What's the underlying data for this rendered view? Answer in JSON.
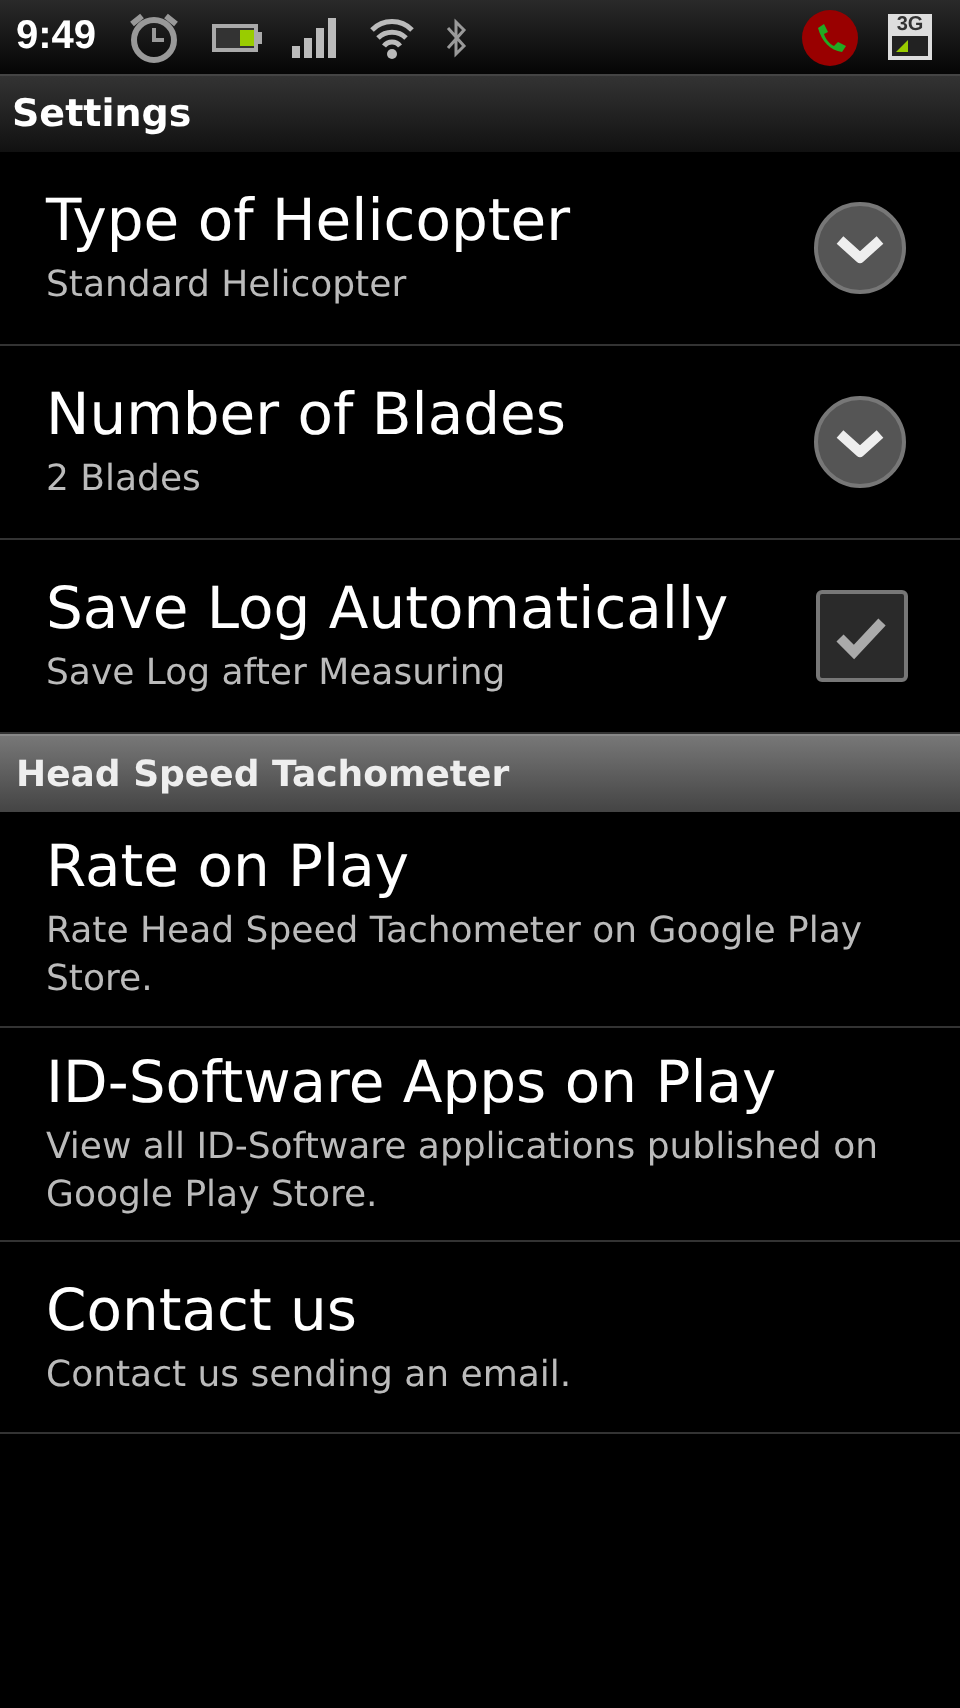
{
  "status_bar": {
    "time": "9:49",
    "network": "3G"
  },
  "screen_title": "Settings",
  "sections": [
    {
      "items": [
        {
          "kind": "list",
          "title": "Type of Helicopter",
          "summary": "Standard Helicopter"
        },
        {
          "kind": "list",
          "title": "Number of Blades",
          "summary": "2 Blades"
        },
        {
          "kind": "checkbox",
          "title": "Save Log Automatically",
          "summary": "Save Log after Measuring",
          "checked": true
        }
      ]
    },
    {
      "header": "Head Speed Tachometer",
      "items": [
        {
          "kind": "plain",
          "title": "Rate on Play",
          "summary": "Rate Head Speed Tachometer on Google Play Store."
        },
        {
          "kind": "plain",
          "title": "ID-Software Apps on Play",
          "summary": "View all ID-Software applications published on Google Play Store."
        },
        {
          "kind": "plain",
          "title": "Contact us",
          "summary": "Contact us sending an email."
        }
      ]
    }
  ]
}
